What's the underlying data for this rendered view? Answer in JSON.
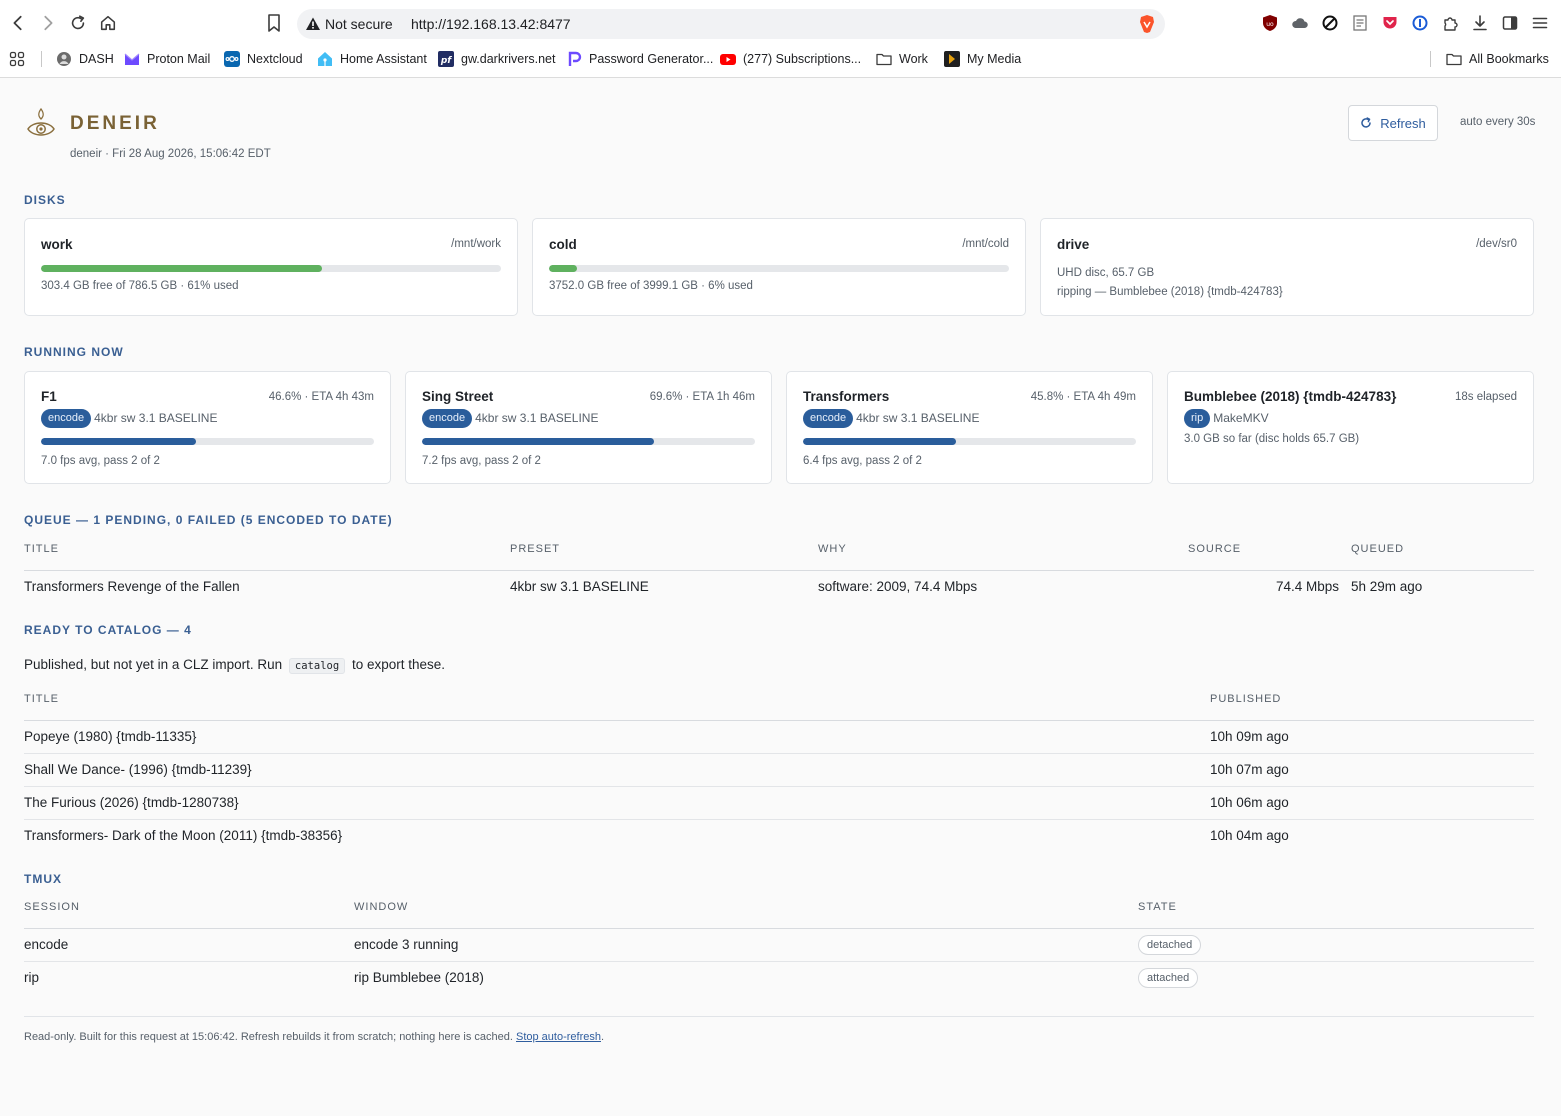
{
  "browser": {
    "security_label": "Not secure",
    "url": "http://192.168.13.42:8477",
    "bookmarks": [
      {
        "label": "DASH",
        "icon": "dash-icon"
      },
      {
        "label": "Proton Mail",
        "icon": "proton-mail-icon"
      },
      {
        "label": "Nextcloud",
        "icon": "nextcloud-icon"
      },
      {
        "label": "Home Assistant",
        "icon": "home-assistant-icon"
      },
      {
        "label": "gw.darkrivers.net",
        "icon": "pfsense-icon"
      },
      {
        "label": "Password Generator...",
        "icon": "password-generator-icon"
      },
      {
        "label": "(277) Subscriptions...",
        "icon": "youtube-icon"
      },
      {
        "label": "Work",
        "icon": "folder-icon"
      },
      {
        "label": "My Media",
        "icon": "plex-icon"
      }
    ],
    "all_bookmarks": "All Bookmarks"
  },
  "header": {
    "name": "DENEIR",
    "subtitle": "deneir · Fri 28 Aug 2026, 15:06:42 EDT",
    "refresh_label": "Refresh",
    "auto_note": "auto every 30s"
  },
  "disks": {
    "heading": "DISKS",
    "items": [
      {
        "name": "work",
        "path": "/mnt/work",
        "used_pct": 61,
        "meta": "303.4 GB free of 786.5 GB · 61% used"
      },
      {
        "name": "cold",
        "path": "/mnt/cold",
        "used_pct": 6,
        "meta": "3752.0 GB free of 3999.1 GB · 6% used"
      },
      {
        "name": "drive",
        "path": "/dev/sr0",
        "line1": "UHD disc, 65.7 GB",
        "line2": "ripping — Bumblebee (2018) {tmdb-424783}"
      }
    ]
  },
  "running": {
    "heading": "RUNNING NOW",
    "jobs": [
      {
        "title": "F1",
        "status": "46.6% · ETA 4h 43m",
        "badge": "encode",
        "detail": "4kbr sw 3.1 BASELINE",
        "progress": 46.6,
        "meta": "7.0 fps avg, pass 2 of 2"
      },
      {
        "title": "Sing Street",
        "status": "69.6% · ETA 1h 46m",
        "badge": "encode",
        "detail": "4kbr sw 3.1 BASELINE",
        "progress": 69.6,
        "meta": "7.2 fps avg, pass 2 of 2"
      },
      {
        "title": "Transformers",
        "status": "45.8% · ETA 4h 49m",
        "badge": "encode",
        "detail": "4kbr sw 3.1 BASELINE",
        "progress": 45.8,
        "meta": "6.4 fps avg, pass 2 of 2"
      },
      {
        "title": "Bumblebee (2018) {tmdb-424783}",
        "status": "18s elapsed",
        "badge": "rip",
        "detail": "MakeMKV",
        "meta": "3.0 GB so far (disc holds 65.7 GB)"
      }
    ]
  },
  "queue": {
    "heading": "QUEUE — 1 PENDING, 0 FAILED (5 ENCODED TO DATE)",
    "columns": [
      "TITLE",
      "PRESET",
      "WHY",
      "SOURCE",
      "QUEUED"
    ],
    "rows": [
      {
        "title": "Transformers Revenge of the Fallen",
        "preset": "4kbr sw 3.1 BASELINE",
        "why": "software: 2009, 74.4 Mbps",
        "source": "74.4 Mbps",
        "queued": "5h 29m ago"
      }
    ]
  },
  "catalog": {
    "heading": "READY TO CATALOG — 4",
    "note_before": "Published, but not yet in a CLZ import. Run",
    "note_code": "catalog",
    "note_after": "to export these.",
    "columns": [
      "TITLE",
      "PUBLISHED"
    ],
    "rows": [
      {
        "title": "Popeye (1980) {tmdb-11335}",
        "published": "10h 09m ago"
      },
      {
        "title": "Shall We Dance- (1996) {tmdb-11239}",
        "published": "10h 07m ago"
      },
      {
        "title": "The Furious (2026) {tmdb-1280738}",
        "published": "10h 06m ago"
      },
      {
        "title": "Transformers- Dark of the Moon (2011) {tmdb-38356}",
        "published": "10h 04m ago"
      }
    ]
  },
  "tmux": {
    "heading": "TMUX",
    "columns": [
      "SESSION",
      "WINDOW",
      "STATE"
    ],
    "rows": [
      {
        "session": "encode",
        "window": "encode 3 running",
        "state": "detached"
      },
      {
        "session": "rip",
        "window": "rip Bumblebee (2018)",
        "state": "attached"
      }
    ]
  },
  "footer": {
    "text": "Read-only. Built for this request at 15:06:42. Refresh rebuilds it from scratch; nothing here is cached.",
    "link": "Stop auto-refresh",
    "end": "."
  },
  "colors": {
    "disk_bar": "#5fb15f",
    "job_bar": "#2a5d9b",
    "section": "#3a5f92",
    "brand": "#7a6235"
  }
}
